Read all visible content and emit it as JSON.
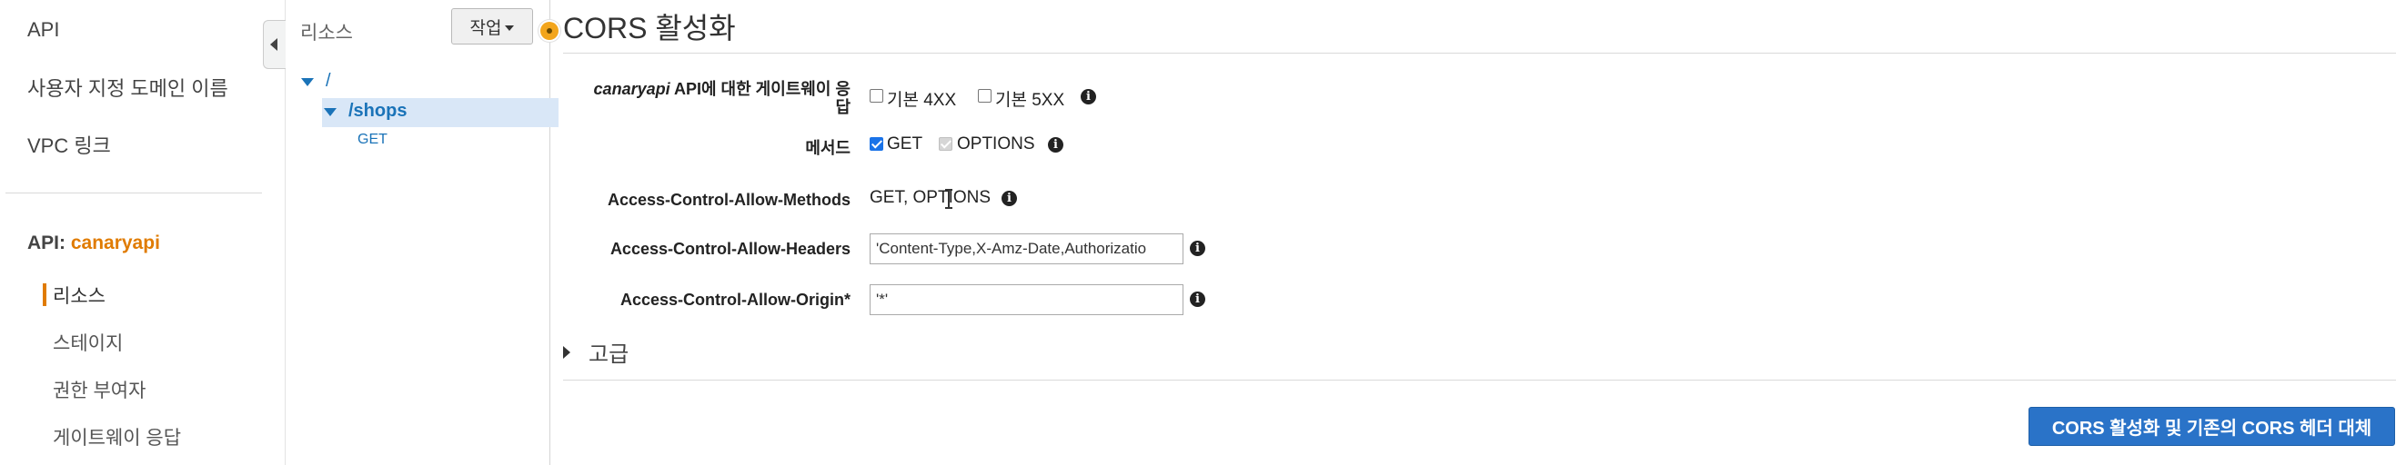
{
  "left_nav": {
    "top_links": [
      "API",
      "사용자 지정 도메인 이름",
      "VPC 링크"
    ],
    "api_label": "API:",
    "api_name": "canaryapi",
    "sub_items": [
      "리소스",
      "스테이지",
      "권한 부여자",
      "게이트웨이 응답"
    ]
  },
  "resources": {
    "title": "리소스",
    "actions_label": "작업",
    "tree": {
      "root": "/",
      "child": "/shops",
      "method": "GET"
    }
  },
  "main": {
    "title": "CORS 활성화",
    "gateway_label_prefix": "canaryapi",
    "gateway_label_line1": " API에 대한 게이트웨이 응",
    "gateway_label_line2": "답",
    "gateway_options": [
      {
        "label": "기본 4XX",
        "checked": false
      },
      {
        "label": "기본 5XX",
        "checked": false
      }
    ],
    "methods_label": "메서드",
    "method_options": [
      {
        "label": "GET",
        "checked": true
      },
      {
        "label": "OPTIONS",
        "checked": true,
        "disabled": true
      }
    ],
    "allow_methods_label": "Access-Control-Allow-Methods",
    "allow_methods_value": "GET, OPTIONS",
    "allow_headers_label": "Access-Control-Allow-Headers",
    "allow_headers_value": "'Content-Type,X-Amz-Date,Authorizatio",
    "allow_origin_label": "Access-Control-Allow-Origin*",
    "allow_origin_value": "'*'",
    "advanced_label": "고급",
    "submit_label": "CORS 활성화 및 기존의 CORS 헤더 대체"
  },
  "colors": {
    "accent": "#e07b00",
    "link": "#1a73b8",
    "primary_button": "#2a73c8",
    "selection": "#d9e7f7"
  },
  "icons": {
    "info": "info-icon",
    "collapse": "collapse-left-icon",
    "expand": "caret-down-icon"
  }
}
